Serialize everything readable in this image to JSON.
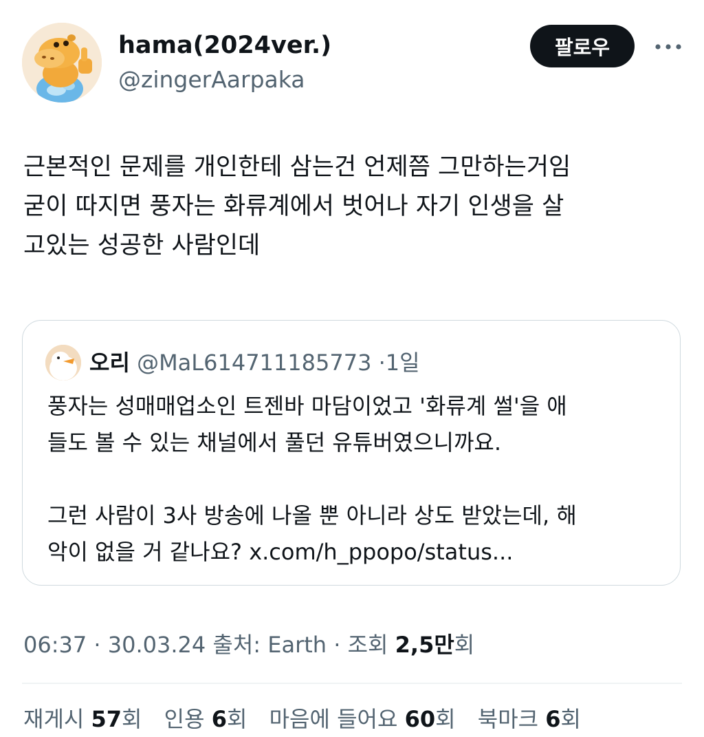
{
  "author": {
    "display_name": "hama(2024ver.)",
    "handle": "@zingerAarpaka",
    "avatar_icon": "hippo-thumbs-up-avatar"
  },
  "actions": {
    "follow_label": "팔로우",
    "more_icon": "more-horizontal-icon"
  },
  "tweet": {
    "lines": [
      "근본적인 문제를 개인한테 삼는건 언제쯤 그만하는거임",
      "굳이 따지면 풍자는 화류계에서 벗어나 자기 인생을 살",
      "고있는 성공한 사람인데"
    ]
  },
  "quote": {
    "display_name": "오리",
    "handle": "@MaL614711185773",
    "separator": "·",
    "time": "1일",
    "avatar_icon": "duck-avatar",
    "lines": [
      "풍자는 성매매업소인 트젠바 마담이었고 '화류계 썰'을 애",
      "들도 볼 수 있는 채널에서 풀던 유튜버였으니까요.",
      "",
      "그런 사람이 3사 방송에 나올 뿐 아니라 상도 받았는데, 해",
      "악이 없을 거 같나요? x.com/h_ppopo/status..."
    ]
  },
  "meta": {
    "time": "06:37",
    "sep1": "·",
    "date": "30.03.24",
    "source": "출처: Earth",
    "sep2": "·",
    "views_label": "조회",
    "views_value": "2,5만",
    "views_suffix": "회"
  },
  "stats": {
    "retweets_label": "재게시",
    "retweets_value": "57",
    "retweets_suffix": "회",
    "quotes_label": "인용",
    "quotes_value": "6",
    "quotes_suffix": "회",
    "likes_label": "마음에 들어요",
    "likes_value": "60",
    "likes_suffix": "회",
    "bookmarks_label": "북마크",
    "bookmarks_value": "6",
    "bookmarks_suffix": "회"
  },
  "colors": {
    "text_primary": "#0f1419",
    "text_secondary": "#536471",
    "border": "#cfd9de",
    "button_bg": "#0f1419"
  }
}
